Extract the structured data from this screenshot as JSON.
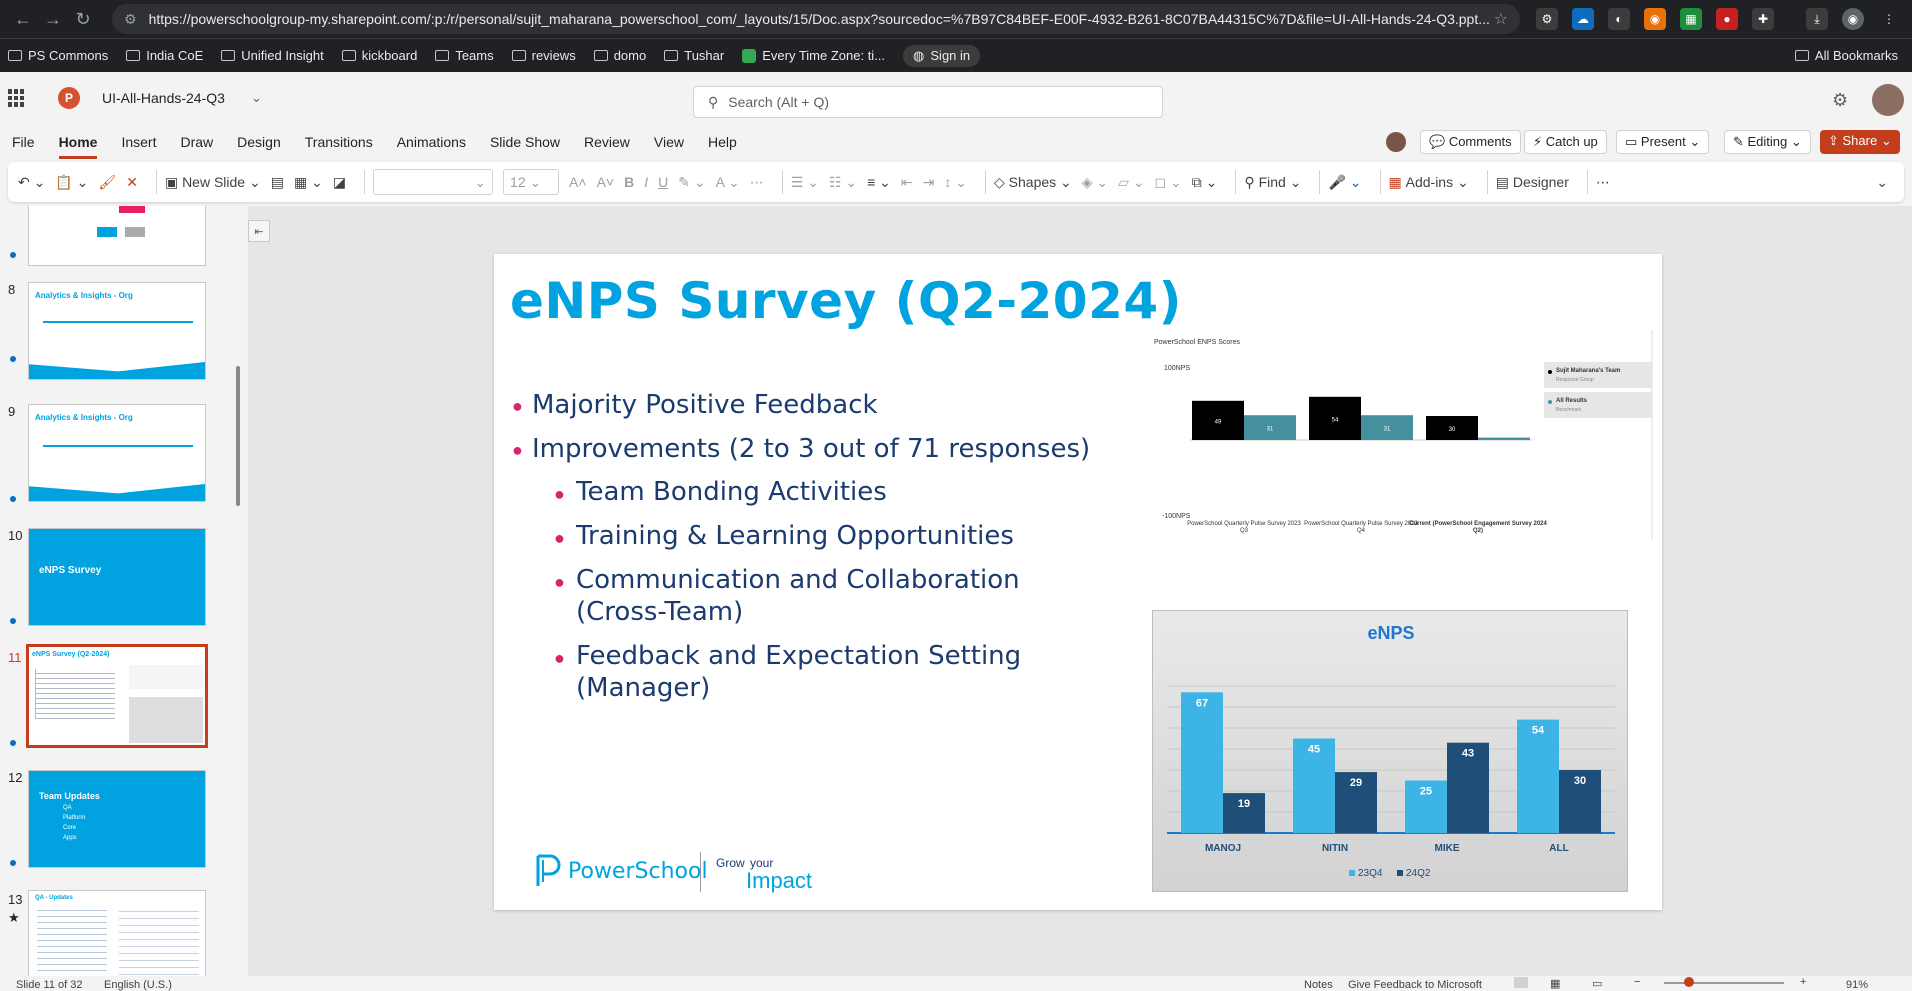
{
  "browser": {
    "url": "https://powerschoolgroup-my.sharepoint.com/:p:/r/personal/sujit_maharana_powerschool_com/_layouts/15/Doc.aspx?sourcedoc=%7B97C84BEF-E00F-4932-B261-8C07BA44315C%7D&file=UI-All-Hands-24-Q3.ppt...",
    "bookmarks": [
      "PS Commons",
      "India CoE",
      "Unified Insight",
      "kickboard",
      "Teams",
      "reviews",
      "domo",
      "Tushar",
      "Every Time Zone: ti...",
      "Sign in"
    ],
    "all_bookmarks": "All Bookmarks"
  },
  "app": {
    "file_name": "UI-All-Hands-24-Q3",
    "search_placeholder": "Search (Alt + Q)",
    "menu": [
      "File",
      "Home",
      "Insert",
      "Draw",
      "Design",
      "Transitions",
      "Animations",
      "Slide Show",
      "Review",
      "View",
      "Help"
    ],
    "active_menu": "Home",
    "actions": {
      "comments": "Comments",
      "catchup": "Catch up",
      "present": "Present",
      "editing": "Editing",
      "share": "Share"
    },
    "accent": "#c43e1c"
  },
  "ribbon": {
    "new_slide": "New Slide",
    "font_size": "12",
    "shapes": "Shapes",
    "find": "Find",
    "addins": "Add-ins",
    "designer": "Designer"
  },
  "thumbnails": [
    {
      "num": "8",
      "title": "Analytics & Insights - Org"
    },
    {
      "num": "9",
      "title": "Analytics & Insights - Org"
    },
    {
      "num": "10",
      "title": "eNPS Survey"
    },
    {
      "num": "11",
      "title": "eNPS Survey (Q2-2024)"
    },
    {
      "num": "12",
      "title": "Team Updates",
      "items": [
        "QA",
        "Platform",
        "Core",
        "Apps"
      ]
    },
    {
      "num": "13",
      "title": "QA - Updates"
    }
  ],
  "slide": {
    "title": "eNPS Survey (Q2-2024)",
    "bullets": [
      "Majority Positive Feedback",
      "Improvements (2 to 3 out of 71 responses)"
    ],
    "sub_bullets": [
      "Team Bonding Activities",
      "Training & Learning Opportunities",
      "Communication and Collaboration (Cross-Team)",
      "Feedback and Expectation Setting (Manager)"
    ],
    "logo_text": "PowerSchool",
    "grow_text": "Grow",
    "your_text": "your",
    "impact_text": "Impact"
  },
  "chart_data": [
    {
      "type": "bar",
      "title": "PowerSchool ENPS Scores",
      "ylim": [
        -100,
        100
      ],
      "ylabel_top": "100NPS",
      "ylabel_bottom": "-100NPS",
      "categories": [
        "PowerSchool Quarterly Pulse Survey 2023 Q3",
        "PowerSchool Quarterly Pulse Survey 2023 Q4",
        "Current (PowerSchool Engagement Survey 2024 Q2)"
      ],
      "series": [
        {
          "name": "Sujit Maharana's Team",
          "values": [
            49,
            54,
            30
          ],
          "color": "#000000"
        },
        {
          "name": "All Results",
          "values": [
            31,
            31,
            3
          ],
          "color": "#45909e"
        }
      ],
      "legend": [
        {
          "name": "Sujit Maharana's Team",
          "sub": "Response Group"
        },
        {
          "name": "All Results",
          "sub": "Benchmark"
        }
      ]
    },
    {
      "type": "bar",
      "title": "eNPS",
      "categories": [
        "MANOJ",
        "NITIN",
        "MIKE",
        "ALL"
      ],
      "series": [
        {
          "name": "23Q4",
          "values": [
            67,
            45,
            25,
            54
          ],
          "color": "#3cb4e6"
        },
        {
          "name": "24Q2",
          "values": [
            19,
            29,
            43,
            30
          ],
          "color": "#1f4e79"
        }
      ],
      "ylim": [
        0,
        80
      ]
    }
  ],
  "status": {
    "slide_info": "Slide 11 of 32",
    "language": "English (U.S.)",
    "notes": "Notes",
    "feedback": "Give Feedback to Microsoft",
    "zoom": "91%"
  }
}
